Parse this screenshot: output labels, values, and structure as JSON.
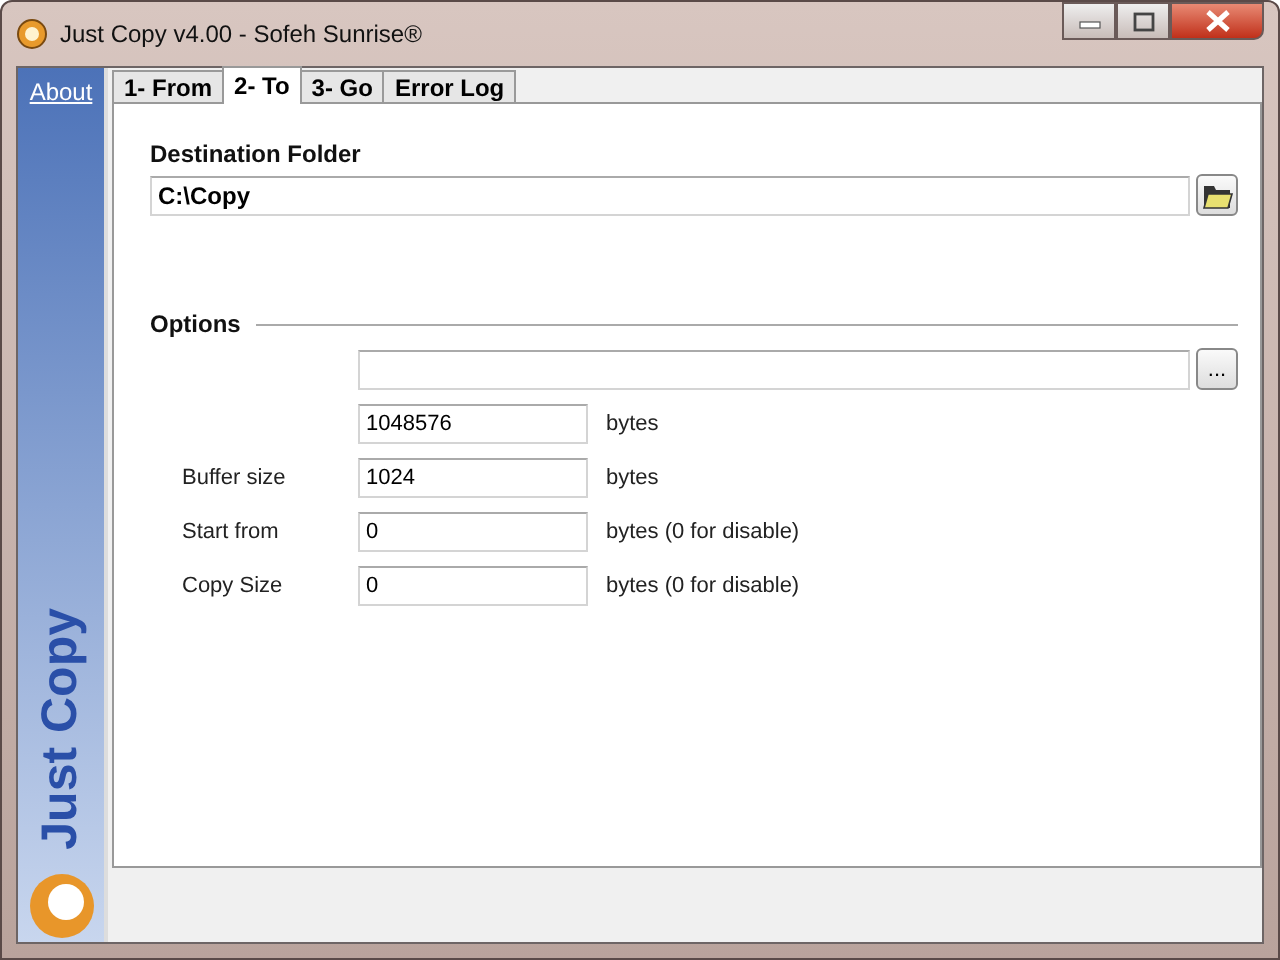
{
  "window": {
    "title": "Just Copy v4.00 - Sofeh Sunrise®"
  },
  "sidebar": {
    "link": "About",
    "banner": "Just Copy"
  },
  "tabs": [
    {
      "label": "1- From",
      "selected": false
    },
    {
      "label": "2- To",
      "selected": true
    },
    {
      "label": "3- Go",
      "selected": false
    },
    {
      "label": "Error Log",
      "selected": false
    }
  ],
  "destination": {
    "label": "Destination Folder",
    "value": "C:\\Copy"
  },
  "options": {
    "title": "Options",
    "browse_button": "...",
    "rows": [
      {
        "value": "1048576",
        "unit": "bytes"
      },
      {
        "label": "Buffer size",
        "value": "1024",
        "unit": "bytes"
      },
      {
        "label": "Start from",
        "value": "0",
        "unit": "bytes (0 for disable)"
      },
      {
        "label": "Copy Size",
        "value": "0",
        "unit": "bytes (0 for disable)"
      }
    ]
  }
}
